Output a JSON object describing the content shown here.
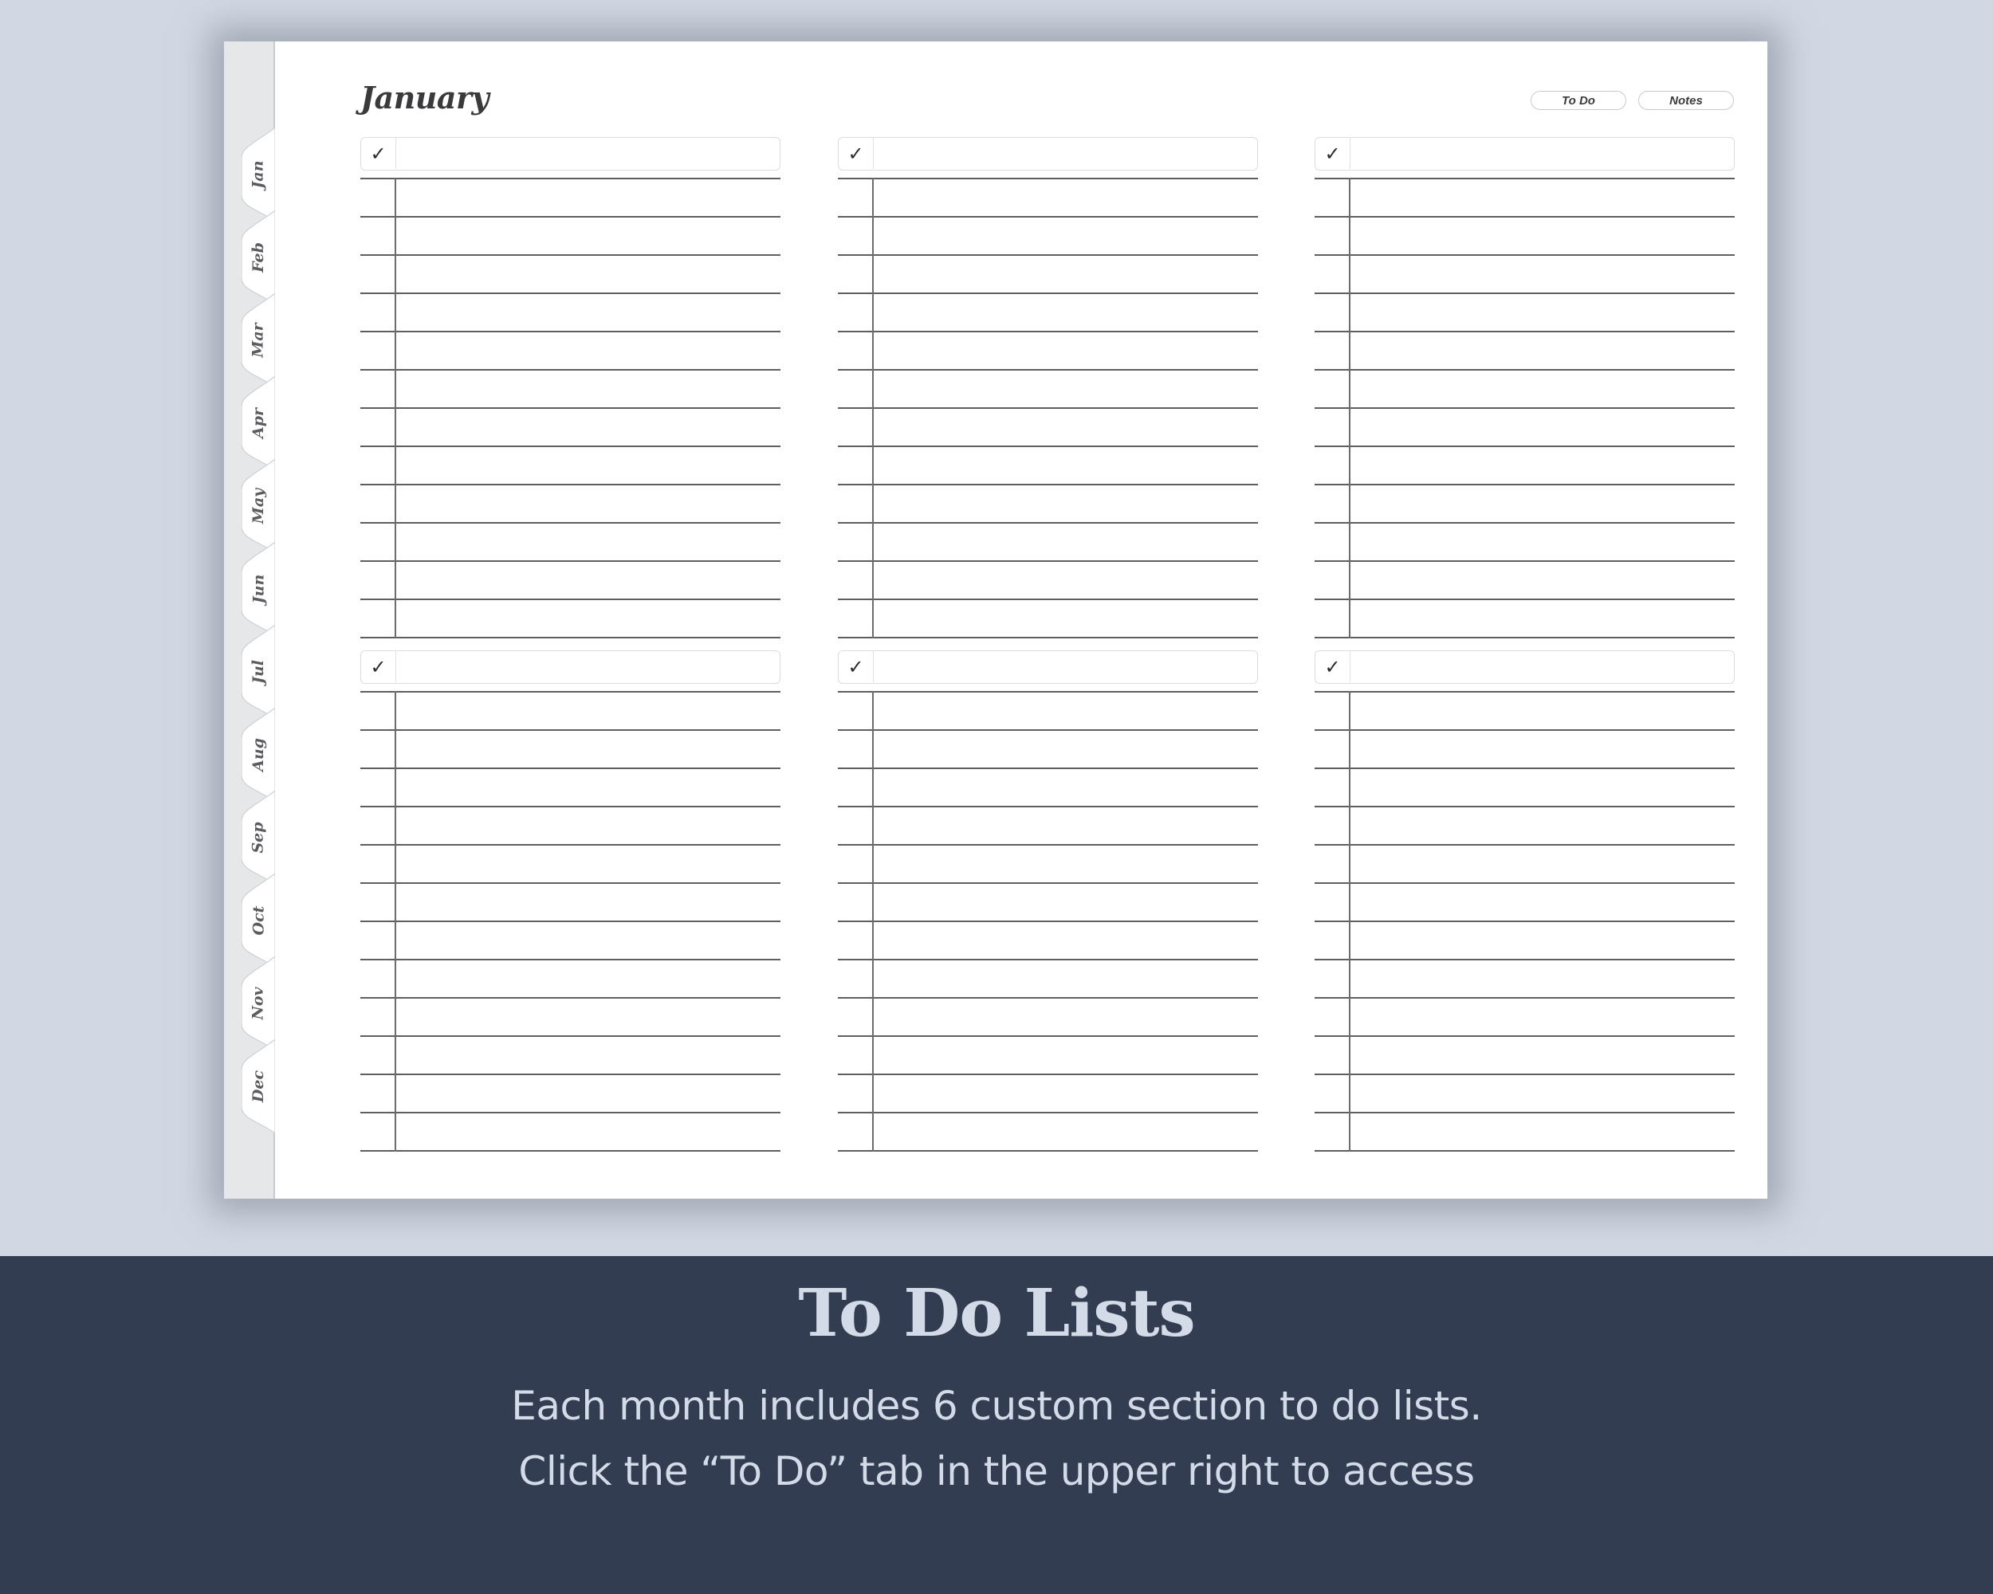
{
  "planner": {
    "month_title": "January",
    "nav_buttons": [
      {
        "label": "To Do",
        "icon": ""
      },
      {
        "label": "Notes",
        "icon": ""
      }
    ],
    "month_tabs": [
      "Jan",
      "Feb",
      "Mar",
      "Apr",
      "May",
      "Jun",
      "Jul",
      "Aug",
      "Sep",
      "Oct",
      "Nov",
      "Dec"
    ],
    "active_month": "Jan",
    "todo_lists": [
      {
        "title": "",
        "check_icon": "checkmark-icon",
        "check_glyph": "✓",
        "rows": 12
      },
      {
        "title": "",
        "check_icon": "checkmark-icon",
        "check_glyph": "✓",
        "rows": 12
      },
      {
        "title": "",
        "check_icon": "checkmark-icon",
        "check_glyph": "✓",
        "rows": 12
      },
      {
        "title": "",
        "check_icon": "checkmark-icon",
        "check_glyph": "✓",
        "rows": 12
      },
      {
        "title": "",
        "check_icon": "checkmark-icon",
        "check_glyph": "✓",
        "rows": 12
      },
      {
        "title": "",
        "check_icon": "checkmark-icon",
        "check_glyph": "✓",
        "rows": 12
      }
    ]
  },
  "banner": {
    "title": "To Do Lists",
    "lines": [
      "Each month includes 6 custom section to do lists.",
      "Click the “To Do” tab in the upper right to access"
    ]
  },
  "colors": {
    "background": "#d2d8e3",
    "banner_bg": "#323d51",
    "banner_text": "#d3dbe8",
    "tab_strip": "#e6e7e9",
    "ink": "#3a3a3c"
  }
}
